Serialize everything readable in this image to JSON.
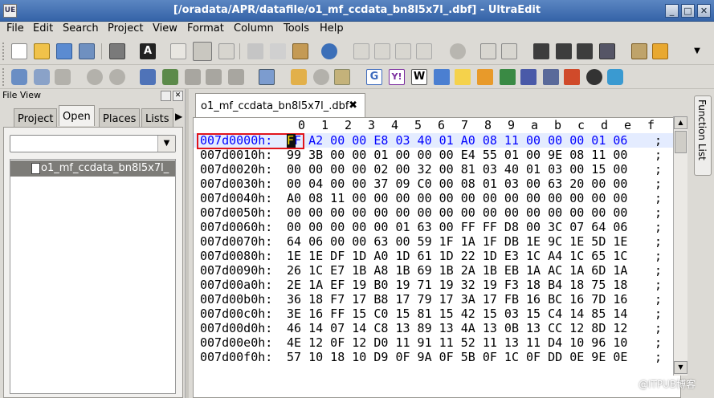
{
  "window": {
    "title": "[/oradata/APR/datafile/o1_mf_ccdata_bn8l5x7l_.dbf] - UltraEdit",
    "app_icon": "UE",
    "controls": [
      "_",
      "□",
      "✕"
    ]
  },
  "menu": [
    "File",
    "Edit",
    "Search",
    "Project",
    "View",
    "Format",
    "Column",
    "Tools",
    "Help"
  ],
  "file_view": {
    "title": "File View",
    "close": "✕",
    "tabs": [
      "Project",
      "Open",
      "Places",
      "Lists"
    ],
    "active_tab": "Open",
    "combo_value": "",
    "selected_file": "o1_mf_ccdata_bn8l5x7l_"
  },
  "editor": {
    "tab_label": "o1_mf_ccdata_bn8l5x7l_.dbf",
    "tab_close": "✖",
    "header": [
      "0",
      "1",
      "2",
      "3",
      "4",
      "5",
      "6",
      "7",
      "8",
      "9",
      "a",
      "b",
      "c",
      "d",
      "e",
      "f"
    ],
    "cursor_char": "F",
    "rows": [
      {
        "addr": "007d0000h:",
        "bytes": "FF A2 00 00 E8 03 40 01 A0 08 11 00 00 00 01 06",
        "semi": ";"
      },
      {
        "addr": "007d0010h:",
        "bytes": "99 3B 00 00 01 00 00 00 E4 55 01 00 9E 08 11 00",
        "semi": ";"
      },
      {
        "addr": "007d0020h:",
        "bytes": "00 00 00 00 02 00 32 00 81 03 40 01 03 00 15 00",
        "semi": ";"
      },
      {
        "addr": "007d0030h:",
        "bytes": "00 04 00 00 37 09 C0 00 08 01 03 00 63 20 00 00",
        "semi": ";"
      },
      {
        "addr": "007d0040h:",
        "bytes": "A0 08 11 00 00 00 00 00 00 00 00 00 00 00 00 00",
        "semi": ";"
      },
      {
        "addr": "007d0050h:",
        "bytes": "00 00 00 00 00 00 00 00 00 00 00 00 00 00 00 00",
        "semi": ";"
      },
      {
        "addr": "007d0060h:",
        "bytes": "00 00 00 00 00 01 63 00 FF FF D8 00 3C 07 64 06",
        "semi": ";"
      },
      {
        "addr": "007d0070h:",
        "bytes": "64 06 00 00 63 00 59 1F 1A 1F DB 1E 9C 1E 5D 1E",
        "semi": ";"
      },
      {
        "addr": "007d0080h:",
        "bytes": "1E 1E DF 1D A0 1D 61 1D 22 1D E3 1C A4 1C 65 1C",
        "semi": ";"
      },
      {
        "addr": "007d0090h:",
        "bytes": "26 1C E7 1B A8 1B 69 1B 2A 1B EB 1A AC 1A 6D 1A",
        "semi": ";"
      },
      {
        "addr": "007d00a0h:",
        "bytes": "2E 1A EF 19 B0 19 71 19 32 19 F3 18 B4 18 75 18",
        "semi": ";"
      },
      {
        "addr": "007d00b0h:",
        "bytes": "36 18 F7 17 B8 17 79 17 3A 17 FB 16 BC 16 7D 16",
        "semi": ";"
      },
      {
        "addr": "007d00c0h:",
        "bytes": "3E 16 FF 15 C0 15 81 15 42 15 03 15 C4 14 85 14",
        "semi": ";"
      },
      {
        "addr": "007d00d0h:",
        "bytes": "46 14 07 14 C8 13 89 13 4A 13 0B 13 CC 12 8D 12",
        "semi": ";"
      },
      {
        "addr": "007d00e0h:",
        "bytes": "4E 12 0F 12 D0 11 91 11 52 11 13 11 D4 10 96 10",
        "semi": ";"
      },
      {
        "addr": "007d00f0h:",
        "bytes": "57 10 18 10 D9 0F 9A 0F 5B 0F 1C 0F DD 0E 9E 0E",
        "semi": ";"
      }
    ]
  },
  "right_panel": {
    "function_list": "Function List"
  },
  "watermark": "@ITPUB博客",
  "colors": {
    "title_bar": "#3f6db0",
    "selection": "#e4ecff",
    "hex_blue": "#0000ff",
    "cursor_box": "#e1141b"
  }
}
